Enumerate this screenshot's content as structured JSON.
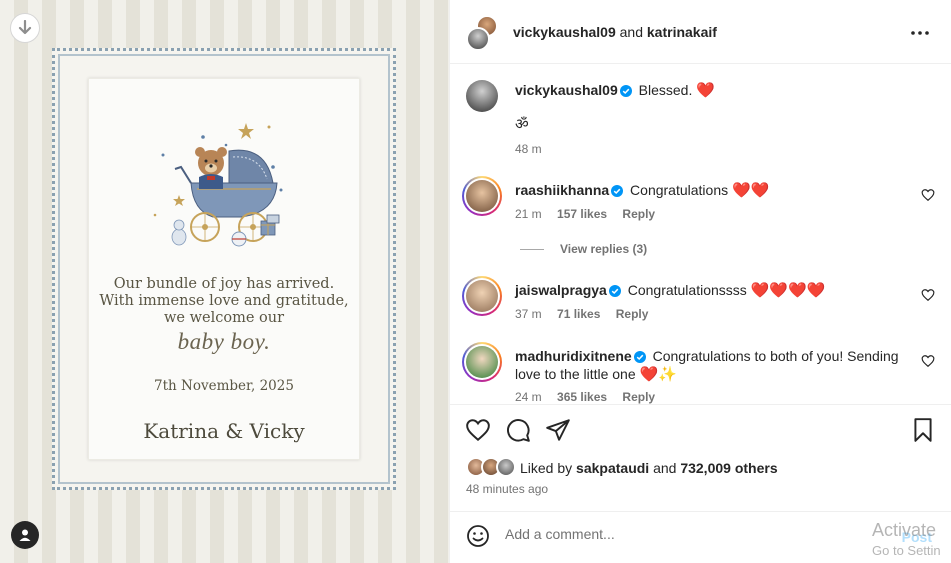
{
  "image_card": {
    "line1": "Our bundle of joy has arrived.",
    "line2": "With immense love and gratitude,",
    "line3": "we welcome our",
    "highlight": "baby boy.",
    "date": "7th November, 2025",
    "names": "Katrina & Vicky"
  },
  "header": {
    "user1": "vickykaushal09",
    "joiner": " and ",
    "user2": "katrinakaif"
  },
  "caption": {
    "username": "vickykaushal09",
    "text": "Blessed.",
    "emoji": "❤️",
    "second_line": "ॐ",
    "time": "48 m"
  },
  "comments": [
    {
      "username": "raashiikhanna",
      "text": "Congratulations",
      "emoji": "❤️❤️",
      "time": "21 m",
      "likes": "157 likes",
      "reply": "Reply",
      "view_replies": "View replies (3)"
    },
    {
      "username": "jaiswalpragya",
      "text": "Congratulationssss",
      "emoji": "❤️❤️❤️❤️",
      "time": "37 m",
      "likes": "71 likes",
      "reply": "Reply"
    },
    {
      "username": "madhuridixitnene",
      "text": "Congratulations to both of you! Sending love to the little one",
      "emoji": "❤️✨",
      "time": "24 m",
      "likes": "365 likes",
      "reply": "Reply"
    }
  ],
  "likes": {
    "prefix": "Liked by ",
    "user": "sakpataudi",
    "joiner": " and ",
    "others": "732,009 others"
  },
  "post_time": "48 minutes ago",
  "add_comment": {
    "placeholder": "Add a comment...",
    "post_label": "Post"
  },
  "watermark": {
    "line1": "Activate",
    "line2": "Go to Settin"
  },
  "colors": {
    "verified": "#0095f6",
    "heart": "#e0142b",
    "muted": "#737373"
  }
}
